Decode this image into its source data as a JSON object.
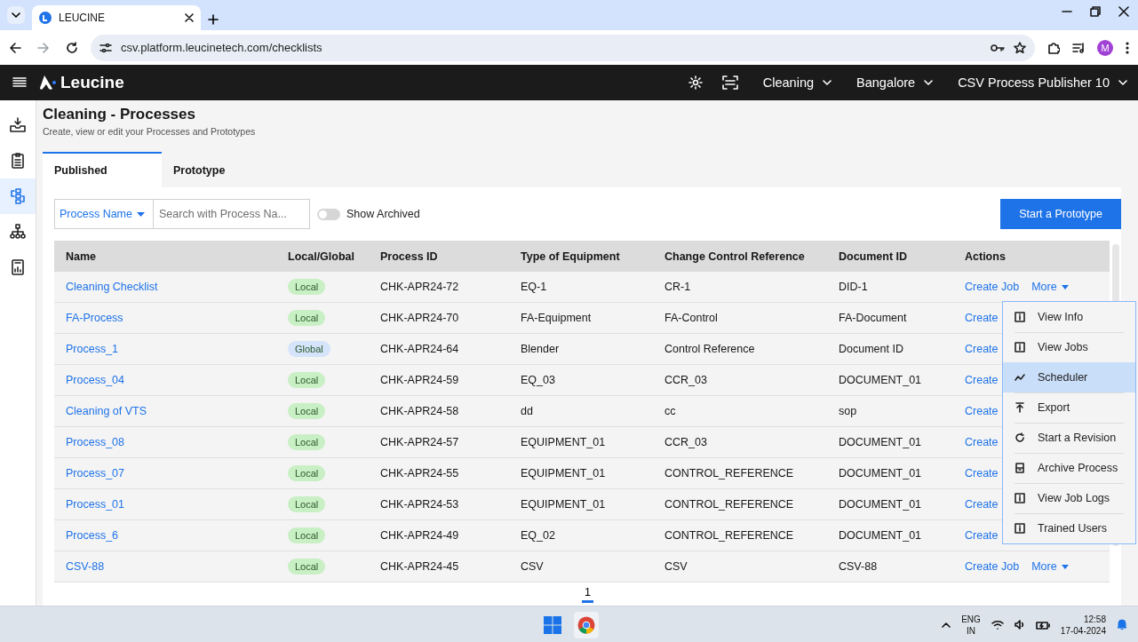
{
  "browser": {
    "tab_title": "LEUCINE",
    "url": "csv.platform.leucinetech.com/checklists",
    "profile_initial": "M"
  },
  "header": {
    "logo": "Leucine",
    "dropdowns": [
      "Cleaning",
      "Bangalore",
      "CSV Process Publisher 10"
    ]
  },
  "sidebar": {
    "items": [
      {
        "kind": "inbox",
        "selected": false
      },
      {
        "kind": "checklist",
        "selected": false
      },
      {
        "kind": "flow",
        "selected": true
      },
      {
        "kind": "tree",
        "selected": false
      },
      {
        "kind": "report",
        "selected": false
      }
    ]
  },
  "page": {
    "title": "Cleaning - Processes",
    "subtitle": "Create, view or edit your Processes and Prototypes",
    "tabs": [
      {
        "label": "Published",
        "selected": true
      },
      {
        "label": "Prototype",
        "selected": false
      }
    ],
    "filter": {
      "dropdown": "Process Name",
      "placeholder": "Search with Process Na...",
      "toggle_label": "Show Archived",
      "toggle_on": false
    },
    "primary_button": "Start a Prototype"
  },
  "table": {
    "columns": [
      "Name",
      "Local/Global",
      "Process ID",
      "Type of Equipment",
      "Change Control Reference",
      "Document ID",
      "Actions"
    ],
    "rows": [
      {
        "name": "Cleaning Checklist",
        "scope": "Local",
        "color": "#c9efc4",
        "process_id": "CHK-APR24-72",
        "equipment": "EQ-1",
        "change_control": "CR-1",
        "document_id": "DID-1",
        "action": "Create Job",
        "more": "More"
      },
      {
        "name": "FA-Process",
        "scope": "Local",
        "color": "#c9efc4",
        "process_id": "CHK-APR24-70",
        "equipment": "FA-Equipment",
        "change_control": "FA-Control",
        "document_id": "FA-Document",
        "action": "Create"
      },
      {
        "name": "Process_1",
        "scope": "Global",
        "color": "#d5e4fb",
        "process_id": "CHK-APR24-64",
        "equipment": "Blender",
        "change_control": "Control Reference",
        "document_id": "Document ID",
        "action": "Create"
      },
      {
        "name": "Process_04",
        "scope": "Local",
        "color": "#c9efc4",
        "process_id": "CHK-APR24-59",
        "equipment": "EQ_03",
        "change_control": "CCR_03",
        "document_id": "DOCUMENT_01",
        "action": "Create"
      },
      {
        "name": "Cleaning of VTS",
        "scope": "Local",
        "color": "#c9efc4",
        "process_id": "CHK-APR24-58",
        "equipment": "dd",
        "change_control": "cc",
        "document_id": "sop",
        "action": "Create"
      },
      {
        "name": "Process_08",
        "scope": "Local",
        "color": "#c9efc4",
        "process_id": "CHK-APR24-57",
        "equipment": "EQUIPMENT_01",
        "change_control": "CCR_03",
        "document_id": "DOCUMENT_01",
        "action": "Create"
      },
      {
        "name": "Process_07",
        "scope": "Local",
        "color": "#c9efc4",
        "process_id": "CHK-APR24-55",
        "equipment": "EQUIPMENT_01",
        "change_control": "CONTROL_REFERENCE",
        "document_id": "DOCUMENT_01",
        "action": "Create"
      },
      {
        "name": "Process_01",
        "scope": "Local",
        "color": "#c9efc4",
        "process_id": "CHK-APR24-53",
        "equipment": "EQUIPMENT_01",
        "change_control": "CONTROL_REFERENCE",
        "document_id": "DOCUMENT_01",
        "action": "Create"
      },
      {
        "name": "Process_6",
        "scope": "Local",
        "color": "#c9efc4",
        "process_id": "CHK-APR24-49",
        "equipment": "EQ_02",
        "change_control": "CONTROL_REFERENCE",
        "document_id": "DOCUMENT_01",
        "action": "Create"
      },
      {
        "name": "CSV-88",
        "scope": "Local",
        "color": "#c9efc4",
        "process_id": "CHK-APR24-45",
        "equipment": "CSV",
        "change_control": "CSV",
        "document_id": "CSV-88",
        "action": "Create Job",
        "more": "More"
      }
    ]
  },
  "more_menu": {
    "items": [
      {
        "label": "View Info",
        "kind": "info",
        "selected": false
      },
      {
        "label": "View Jobs",
        "kind": "info",
        "selected": false
      },
      {
        "label": "Scheduler",
        "kind": "chart",
        "selected": true
      },
      {
        "label": "Export",
        "kind": "export",
        "selected": false
      },
      {
        "label": "Start a Revision",
        "kind": "revision",
        "selected": false
      },
      {
        "label": "Archive Process",
        "kind": "archive",
        "selected": false
      },
      {
        "label": "View Job Logs",
        "kind": "info",
        "selected": false
      },
      {
        "label": "Trained Users",
        "kind": "info",
        "selected": false
      }
    ]
  },
  "pagination": [
    {
      "label": "1",
      "selected": true
    }
  ],
  "taskbar": {
    "language": "ENG",
    "region": "IN",
    "time": "12:58",
    "date": "17-04-2024"
  }
}
